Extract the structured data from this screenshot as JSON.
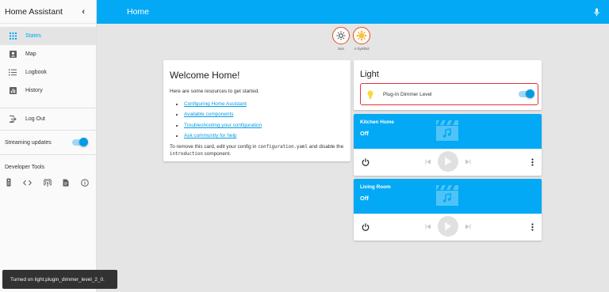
{
  "sidebar": {
    "title": "Home Assistant",
    "items": [
      {
        "label": "States",
        "icon": "grid-icon",
        "active": true
      },
      {
        "label": "Map",
        "icon": "account-box-icon"
      },
      {
        "label": "Logbook",
        "icon": "list-icon"
      },
      {
        "label": "History",
        "icon": "chart-icon"
      }
    ],
    "logout_label": "Log Out",
    "streaming_label": "Streaming updates",
    "streaming_on": true,
    "dev_tools_title": "Developer Tools",
    "dev_tools_icons": [
      "remote-icon",
      "code-icon",
      "broadcast-icon",
      "template-file-icon",
      "info-icon"
    ]
  },
  "header": {
    "title": "Home",
    "mic_icon": "microphone-icon"
  },
  "badges": [
    {
      "label": "Sun",
      "icon": "sun-outline-icon"
    },
    {
      "label": "ır Symbol",
      "icon": "sun-filled-icon"
    }
  ],
  "welcome": {
    "title": "Welcome Home!",
    "intro": "Here are some resources to get started.",
    "links": [
      "Configuring Home Assistant",
      "Available components",
      "Troubleshooting your configuration",
      "Ask community for help"
    ],
    "footer_prefix": "To remove this card, edit your config in ",
    "footer_file": "configuration.yaml",
    "footer_middle": " and disable the ",
    "footer_component": "introduction",
    "footer_suffix": " component."
  },
  "light_card": {
    "title": "Light",
    "entity_name": "Plug-In Dimmer Level",
    "state_on": true
  },
  "media_players": [
    {
      "name": "Kitchen Home",
      "state": "Off"
    },
    {
      "name": "Living Room",
      "state": "Off"
    }
  ],
  "toast": {
    "message": "Turned on light.plugin_dimmer_level_2_0."
  },
  "colors": {
    "accent": "#03a9f4",
    "highlight": "#e0313a"
  }
}
